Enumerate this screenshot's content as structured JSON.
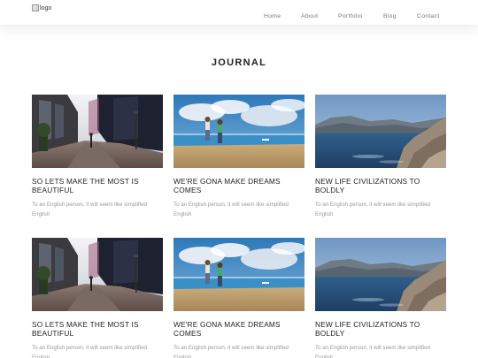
{
  "header": {
    "logo_alt": "logo",
    "nav": [
      "Home",
      "About",
      "Portfolio",
      "Blog",
      "Contact"
    ]
  },
  "section": {
    "title": "JOURNAL"
  },
  "posts": [
    {
      "title": "SO LETS MAKE THE MOST IS BEAUTIFUL",
      "excerpt": "To an English person, it will seem like simplified English",
      "image": "street"
    },
    {
      "title": "WE'RE GONA MAKE DREAMS COMES",
      "excerpt": "To an English person, it will seem like simplified English",
      "image": "beach"
    },
    {
      "title": "NEW LIFE CIVILIZATIONS TO BOLDLY",
      "excerpt": "To an English person, it will seem like simplified English",
      "image": "coast"
    },
    {
      "title": "SO LETS MAKE THE MOST IS BEAUTIFUL",
      "excerpt": "To an English person, it will seem like simplified English",
      "image": "street"
    },
    {
      "title": "WE'RE GONA MAKE DREAMS COMES",
      "excerpt": "To an English person, it will seem like simplified English",
      "image": "beach"
    },
    {
      "title": "NEW LIFE CIVILIZATIONS TO BOLDLY",
      "excerpt": "To an English person, it will seem like simplified English",
      "image": "coast"
    }
  ]
}
